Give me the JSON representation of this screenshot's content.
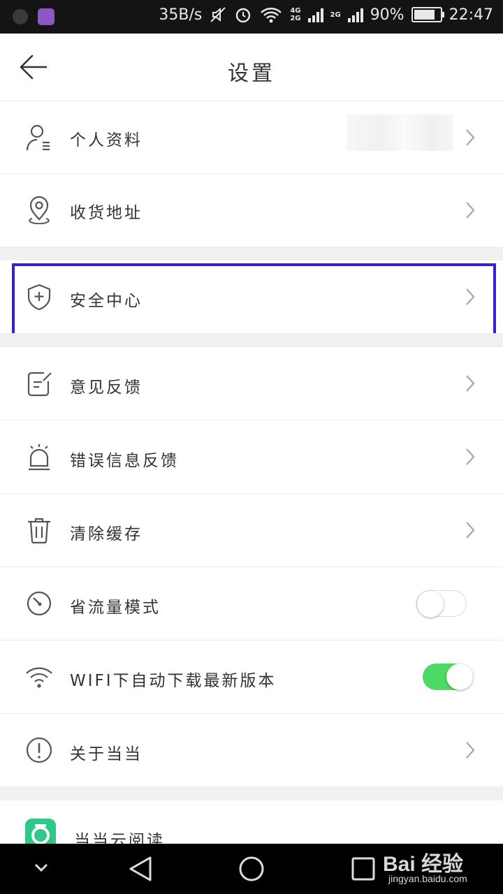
{
  "status_bar": {
    "net_speed": "35B/s",
    "net_tag_top": "4G",
    "net_tag_bottom": "2G",
    "net_tag_2": "2G",
    "battery": "90%",
    "battery_level": 0.9,
    "time": "22:47"
  },
  "header": {
    "title": "设置"
  },
  "rows": [
    {
      "label": "个人资料",
      "icon": "person-icon"
    },
    {
      "label": "收货地址",
      "icon": "location-pin-icon"
    },
    {
      "label": "安全中心",
      "icon": "shield-plus-icon"
    },
    {
      "label": "意见反馈",
      "icon": "note-edit-icon"
    },
    {
      "label": "错误信息反馈",
      "icon": "alarm-light-icon"
    },
    {
      "label": "清除缓存",
      "icon": "trash-icon"
    },
    {
      "label": "省流量模式",
      "icon": "gauge-icon",
      "toggle": false
    },
    {
      "label": "WIFI下自动下载最新版本",
      "icon": "wifi-icon",
      "toggle": true
    },
    {
      "label": "关于当当",
      "icon": "info-exclamation-icon"
    },
    {
      "label": "当当云阅读",
      "icon": "dangdang-app-icon"
    }
  ],
  "colors": {
    "toggle_on": "#4cd964",
    "highlight": "#3a1fd6",
    "app_icon": "#2cc98a"
  },
  "watermark": {
    "main": "Bai 经验",
    "sub": "jingyan.baidu.com"
  }
}
